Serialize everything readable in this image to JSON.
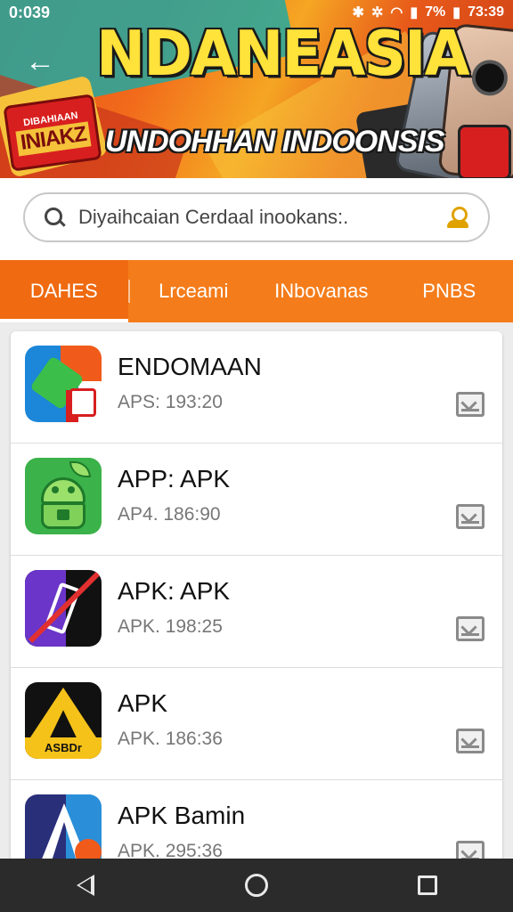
{
  "status_bar": {
    "left": "0:039",
    "right_icons": [
      "bluetooth-icon",
      "wifi-icon",
      "signal-icon",
      "battery-icon"
    ],
    "battery": "7%",
    "time": "73:39"
  },
  "banner": {
    "title": "NDANEASIA",
    "subtitle": "UNDOHHAN INDOONSIS",
    "badge_top": "DIBAHIAAN",
    "badge_main": "INIAKZ"
  },
  "search": {
    "placeholder": "Diyaihcaian Cerdaal inookans:."
  },
  "tabs": [
    {
      "label": "DAHES",
      "active": true
    },
    {
      "label": "Lrceami",
      "active": false
    },
    {
      "label": "INbovanas",
      "active": false
    },
    {
      "label": "PNBS",
      "active": false
    }
  ],
  "apps": [
    {
      "name": "ENDOMAAN",
      "meta": "APS: 193:20"
    },
    {
      "name": "APP: APK",
      "meta": "AP4. 186:90"
    },
    {
      "name": "APK: APK",
      "meta": "APK. 198:25"
    },
    {
      "name": "APK",
      "meta": "APK. 186:36"
    },
    {
      "name": "APK Bamin",
      "meta": "APK. 295:36"
    }
  ],
  "app4_icon_text": "ASBDr",
  "colors": {
    "accent": "#f47c1a",
    "tab_active": "#ef6a10",
    "navbar": "#2b2b2b"
  }
}
